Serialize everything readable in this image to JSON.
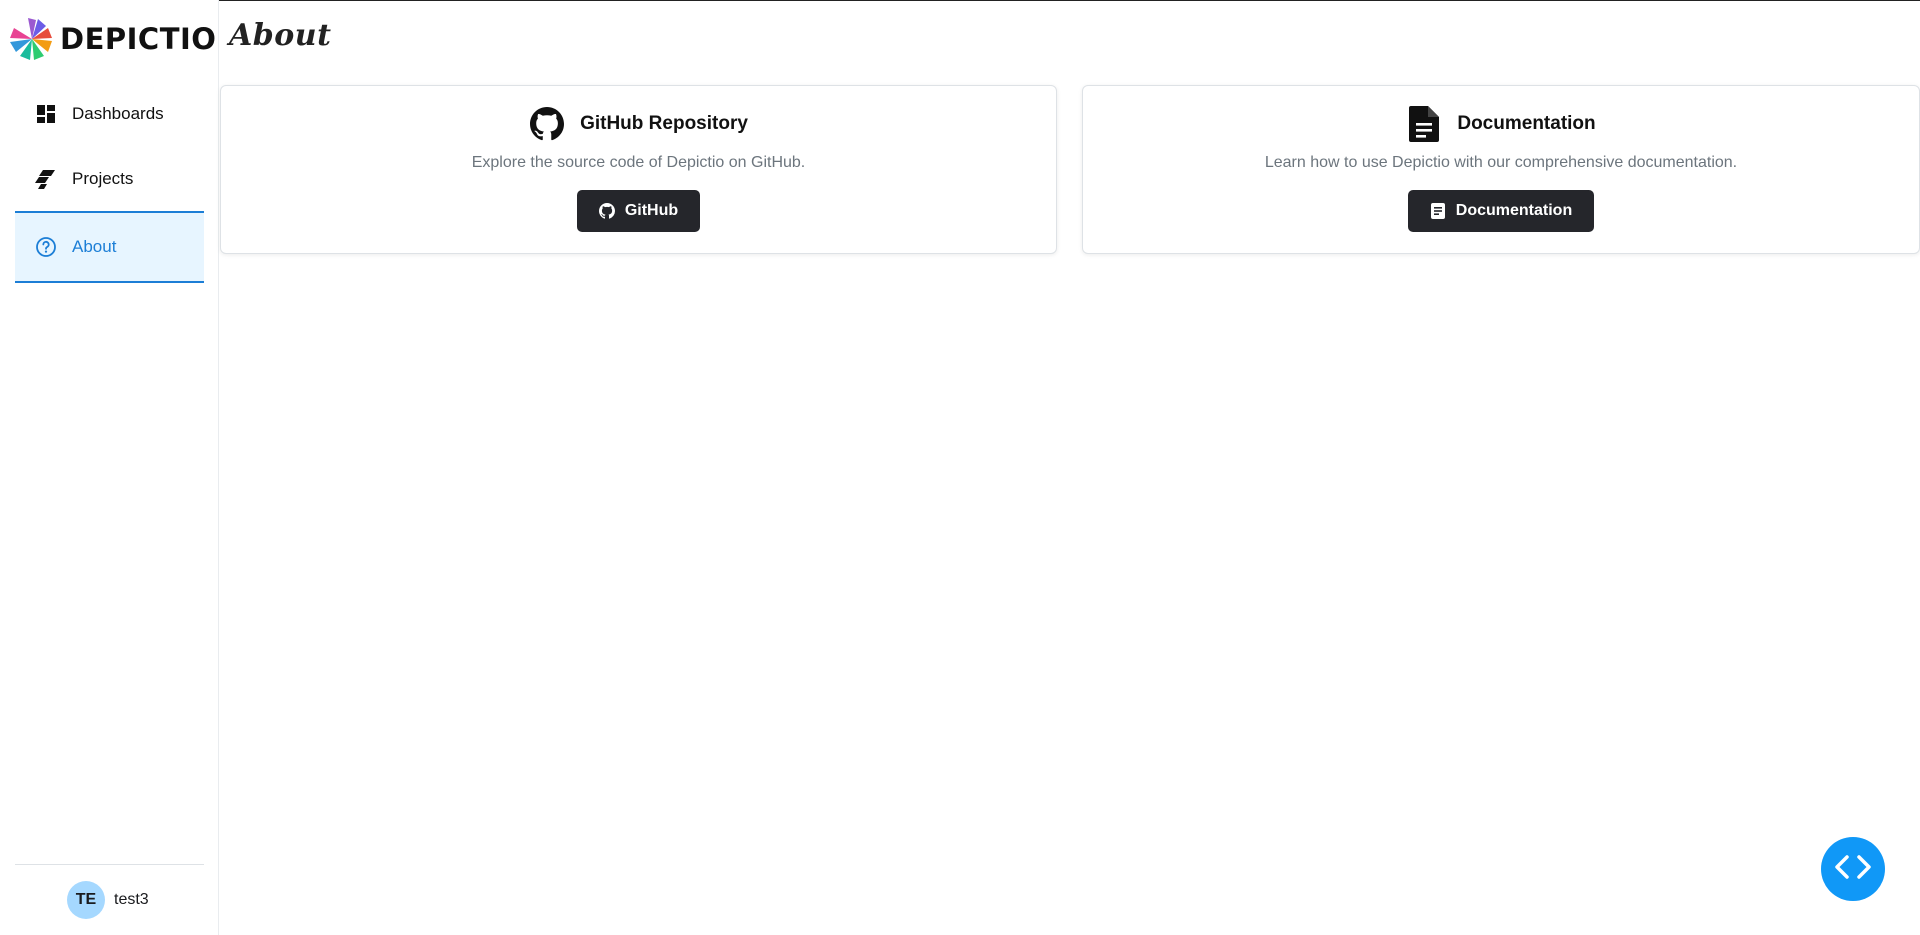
{
  "app": {
    "brand": "DEPICTIO",
    "logo_icon": "depictio-logo-icon"
  },
  "header": {
    "title": "About"
  },
  "sidebar": {
    "items": [
      {
        "label": "Dashboards",
        "icon": "dashboard-icon",
        "active": false
      },
      {
        "label": "Projects",
        "icon": "projects-icon",
        "active": false
      },
      {
        "label": "About",
        "icon": "help-circle-icon",
        "active": true
      }
    ],
    "user": {
      "initials": "TE",
      "name": "test3"
    }
  },
  "cards": {
    "github": {
      "icon": "github-icon",
      "title": "GitHub Repository",
      "description": "Explore the source code of Depictio on GitHub.",
      "button_label": "GitHub"
    },
    "docs": {
      "icon": "document-icon",
      "title": "Documentation",
      "description": "Learn how to use Depictio with our comprehensive documentation.",
      "button_label": "Documentation"
    }
  },
  "fab": {
    "icon": "code-brackets-icon"
  },
  "colors": {
    "accent": "#1c7ed6",
    "active_bg": "#e7f5ff",
    "button_dark": "#25262b",
    "fab": "#1098f7",
    "avatar": "#a5d8ff"
  }
}
